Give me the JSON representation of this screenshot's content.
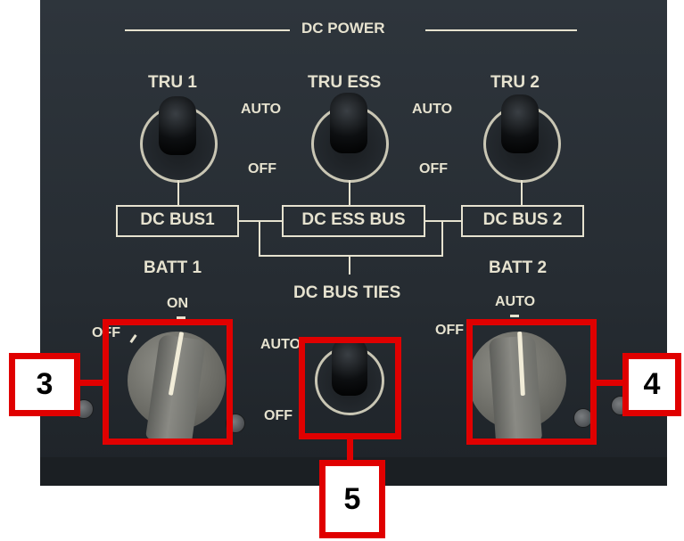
{
  "panel": {
    "title": "DC POWER",
    "tru1_label": "TRU 1",
    "tru_ess_label": "TRU ESS",
    "tru2_label": "TRU 2",
    "auto_left": "AUTO",
    "auto_right": "AUTO",
    "off_left": "OFF",
    "off_right": "OFF",
    "dc_bus1": "DC BUS1",
    "dc_ess_bus": "DC ESS BUS",
    "dc_bus2": "DC BUS 2",
    "batt1": "BATT 1",
    "batt2": "BATT 2",
    "dc_bus_ties": "DC BUS TIES",
    "batt1_on": "ON",
    "batt1_off": "OFF",
    "ties_auto": "AUTO",
    "ties_off": "OFF",
    "batt2_auto": "AUTO",
    "batt2_off": "OFF"
  },
  "callouts": {
    "batt1_number": "3",
    "batt2_number": "4",
    "ties_number": "5"
  },
  "colors": {
    "callout": "#e00000",
    "panel": "#2a3036",
    "legend": "#e6e2cf"
  }
}
